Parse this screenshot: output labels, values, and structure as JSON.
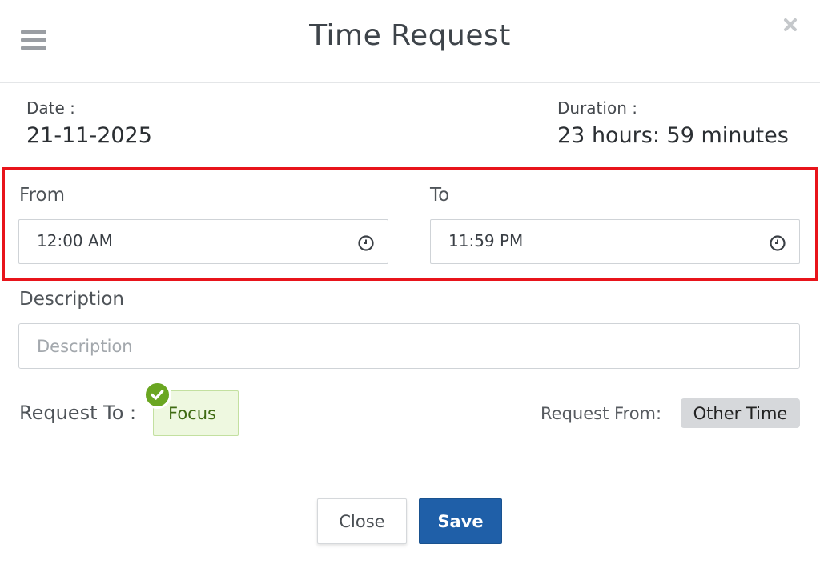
{
  "header": {
    "title": "Time Request"
  },
  "info": {
    "date_label": "Date :",
    "date_value": "21-11-2025",
    "duration_label": "Duration :",
    "duration_value": "23 hours: 59 minutes"
  },
  "from": {
    "label": "From",
    "value": "12:00 AM"
  },
  "to": {
    "label": "To",
    "value": "11:59 PM"
  },
  "description": {
    "label": "Description",
    "placeholder": "Description",
    "value": ""
  },
  "request_to": {
    "label": "Request To :",
    "selected": "Focus"
  },
  "request_from": {
    "label": "Request From:",
    "value": "Other Time"
  },
  "buttons": {
    "close_label": "Close",
    "save_label": "Save"
  },
  "colors": {
    "highlight": "#e8141b",
    "save_button": "#1f5fa8",
    "check_badge": "#6aa621",
    "focus_chip_bg": "#eef8e0"
  },
  "icons": {
    "menu": "hamburger-menu-icon",
    "close": "close-icon",
    "from_clock": "clock-icon",
    "to_clock": "clock-icon",
    "selected": "check-circle-icon"
  }
}
